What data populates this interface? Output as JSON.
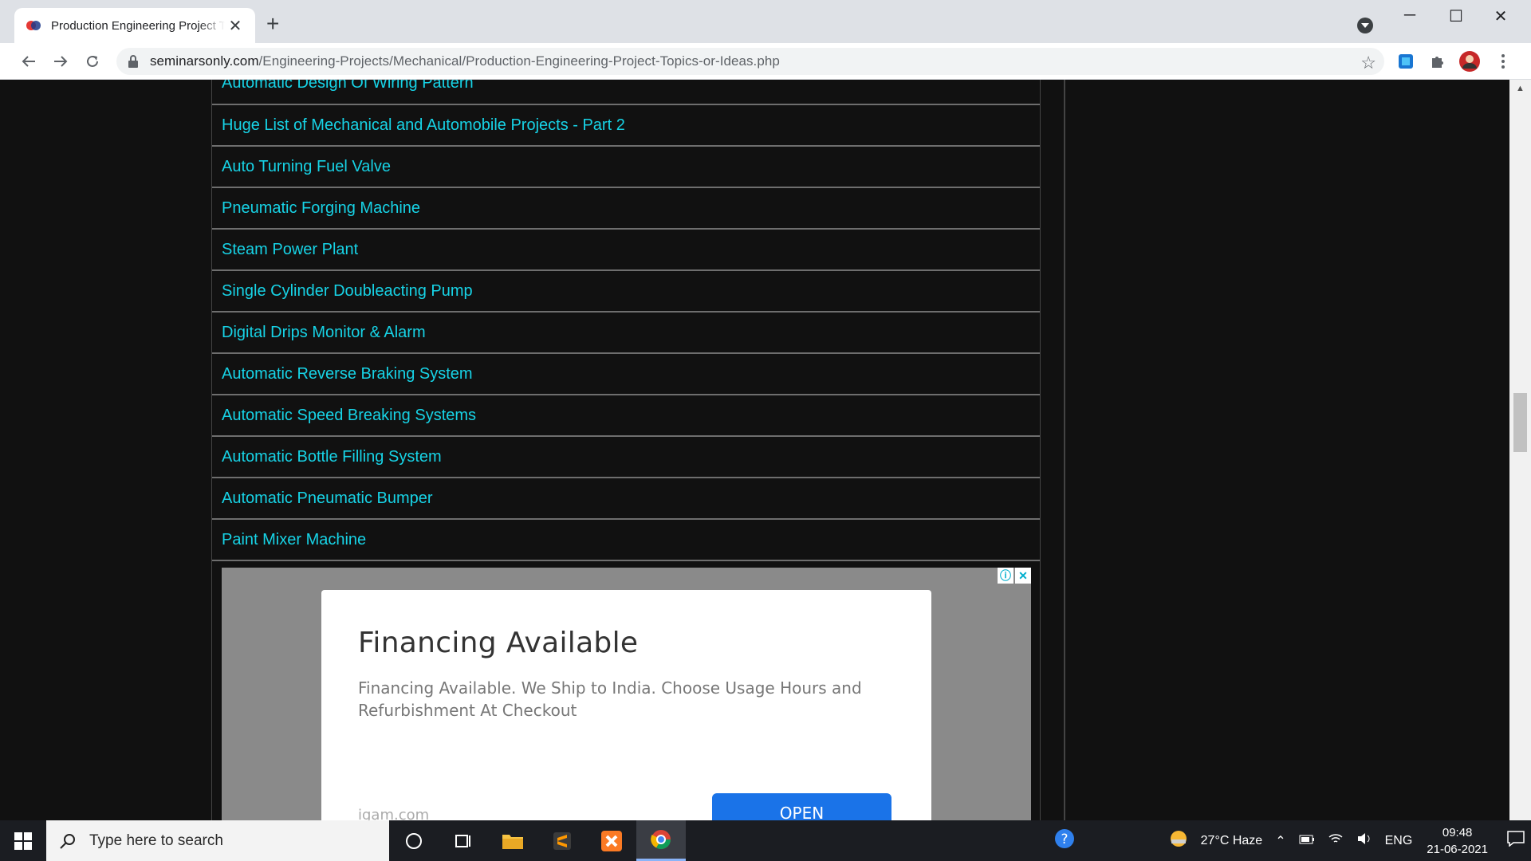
{
  "browser": {
    "tab_title": "Production Engineering Project T",
    "url_host": "seminarsonly.com",
    "url_path": "/Engineering-Projects/Mechanical/Production-Engineering-Project-Topics-or-Ideas.php"
  },
  "topics": [
    "Automatic Design Of Wiring Pattern",
    "Huge List of Mechanical and Automobile Projects - Part 2",
    "Auto Turning Fuel Valve",
    "Pneumatic Forging Machine",
    "Steam Power Plant",
    "Single Cylinder Doubleacting Pump",
    "Digital Drips Monitor & Alarm",
    "Automatic Reverse Braking System",
    "Automatic Speed Breaking Systems",
    "Automatic Bottle Filling System",
    "Automatic Pneumatic Bumper",
    "Paint Mixer Machine"
  ],
  "ad": {
    "title": "Financing Available",
    "text": "Financing Available. We Ship to India. Choose Usage Hours and Refurbishment At Checkout",
    "domain": "igam.com",
    "cta": "OPEN"
  },
  "taskbar": {
    "search_placeholder": "Type here to search",
    "weather": "27°C  Haze",
    "language": "ENG",
    "time": "09:48",
    "date": "21-06-2021"
  }
}
